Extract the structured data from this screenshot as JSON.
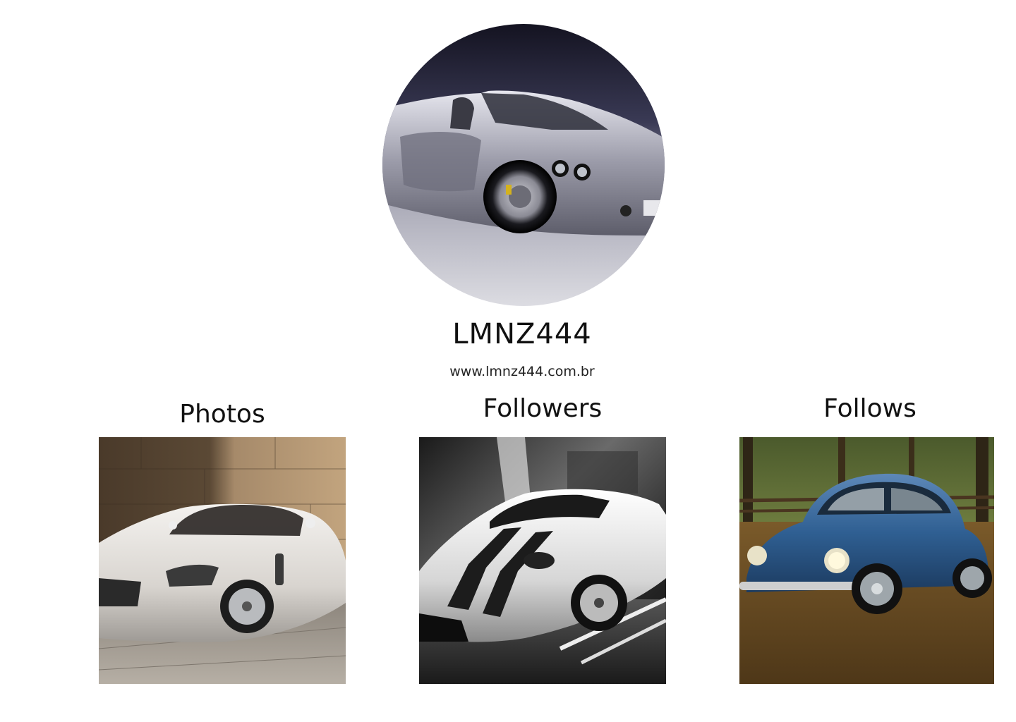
{
  "profile": {
    "avatar_icon": "convertible-sports-car-image",
    "username": "LMNZ444",
    "website": "www.lmnz444.com.br"
  },
  "sections": {
    "photos": {
      "title": "Photos",
      "image": "white-coupe-image"
    },
    "followers": {
      "title": "Followers",
      "image": "black-white-racing-car-image"
    },
    "follows": {
      "title": "Follows",
      "image": "blue-beetle-image"
    }
  },
  "colors": {
    "background": "#ffffff",
    "text": "#111111"
  }
}
